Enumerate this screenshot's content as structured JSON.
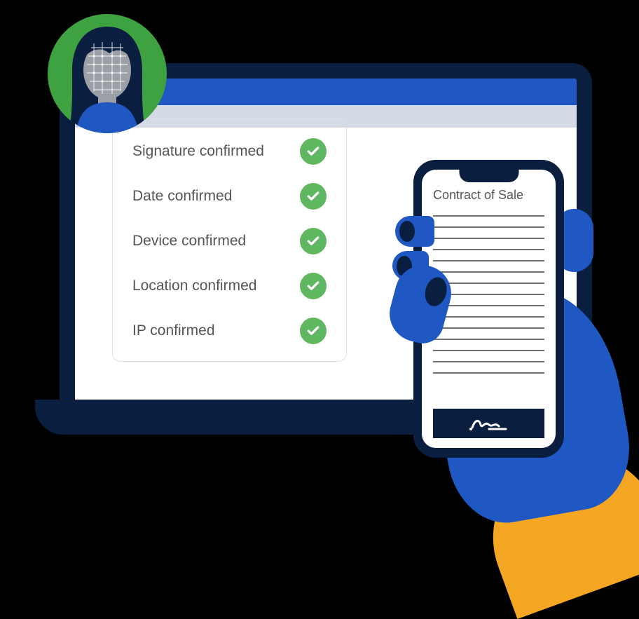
{
  "colors": {
    "navy": "#0a1e3f",
    "blue": "#1f57c3",
    "green": "#5fb760",
    "orange": "#f5a623",
    "grey": "#707070"
  },
  "confirmations": {
    "items": [
      {
        "label": "Signature confirmed"
      },
      {
        "label": "Date confirmed"
      },
      {
        "label": "Device confirmed"
      },
      {
        "label": "Location confirmed"
      },
      {
        "label": "IP confirmed"
      }
    ]
  },
  "phone": {
    "document_title": "Contract of Sale"
  },
  "avatar": {
    "icon": "user-face-scan"
  }
}
